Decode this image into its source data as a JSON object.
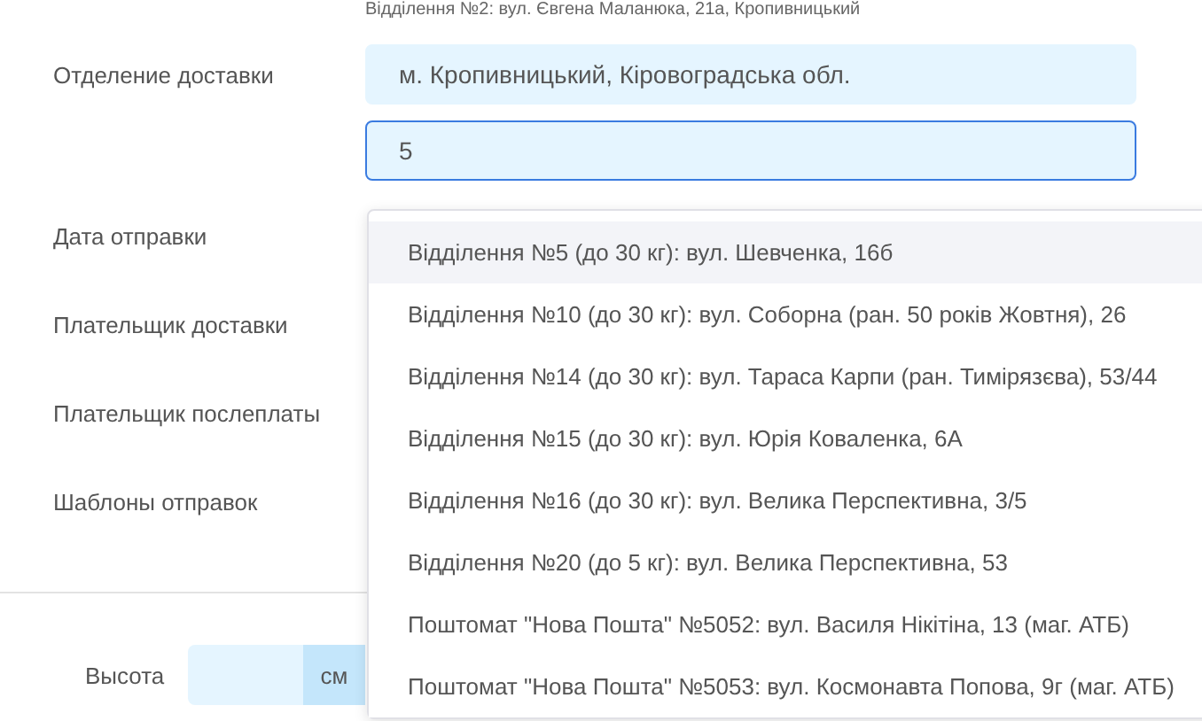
{
  "hint": "Відділення №2: вул. Євгена Маланюка, 21а, Кропивницький",
  "form": {
    "rows": [
      {
        "label": "Отделение доставки"
      },
      {
        "label": "Дата отправки"
      },
      {
        "label": "Плательщик доставки"
      },
      {
        "label": "Плательщик послеплаты"
      },
      {
        "label": "Шаблоны отправок"
      }
    ]
  },
  "city_field": {
    "value": "м. Кропивницький, Кіровоградська обл."
  },
  "branch_field": {
    "value": "5",
    "focused": true
  },
  "dropdown": {
    "items": [
      {
        "text": "Відділення №5 (до 30 кг): вул. Шевченка, 16б",
        "selected": true
      },
      {
        "text": "Відділення №10 (до 30 кг): вул. Соборна (ран. 50 років Жовтня), 26",
        "selected": false
      },
      {
        "text": "Відділення №14 (до 30 кг): вул. Тараса Карпи (ран. Тимірязєва), 53/44",
        "selected": false
      },
      {
        "text": "Відділення №15 (до 30 кг): вул. Юрія Коваленка, 6А",
        "selected": false
      },
      {
        "text": "Відділення №16 (до 30 кг): вул. Велика Перспективна, 3/5",
        "selected": false
      },
      {
        "text": "Відділення №20 (до 5 кг): вул. Велика Перспективна, 53",
        "selected": false
      },
      {
        "text": "Поштомат \"Нова Пошта\" №5052: вул. Василя Нікітіна, 13 (маг. АТБ)",
        "selected": false
      },
      {
        "text": "Поштомат \"Нова Пошта\" №5053: вул. Космонавта Попова, 9г (маг. АТБ)",
        "selected": false
      }
    ]
  },
  "height_field": {
    "label": "Высота",
    "unit": "см"
  }
}
